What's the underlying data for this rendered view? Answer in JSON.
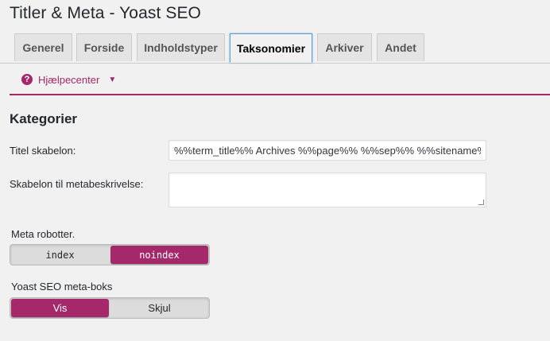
{
  "page": {
    "title": "Titler & Meta - Yoast SEO"
  },
  "tabs": [
    {
      "label": "Generel"
    },
    {
      "label": "Forside"
    },
    {
      "label": "Indholdstyper"
    },
    {
      "label": "Taksonomier",
      "active": true
    },
    {
      "label": "Arkiver"
    },
    {
      "label": "Andet"
    }
  ],
  "help": {
    "label": "Hjælpecenter"
  },
  "section": {
    "title": "Kategorier"
  },
  "form": {
    "title_template_label": "Titel skabelon:",
    "title_template_value": "%%term_title%% Archives %%page%% %%sep%% %%sitename%%",
    "meta_desc_label": "Skabelon til metabeskrivelse:",
    "meta_desc_value": ""
  },
  "meta_robots": {
    "label": "Meta robotter.",
    "options": [
      "index",
      "noindex"
    ],
    "selected": "noindex"
  },
  "metabox": {
    "label": "Yoast SEO meta-boks",
    "options": [
      "Vis",
      "Skjul"
    ],
    "selected": "Vis"
  },
  "colors": {
    "accent": "#a4286a",
    "active_tab_border": "#5b9dd9"
  }
}
